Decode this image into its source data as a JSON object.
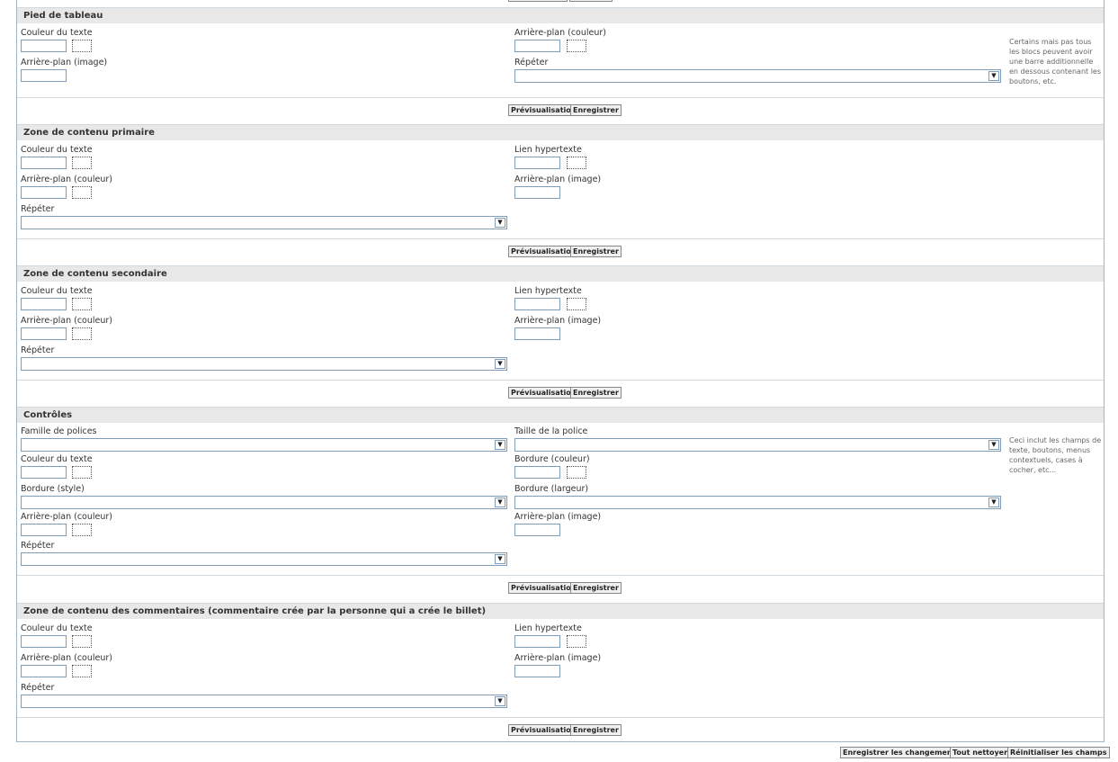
{
  "labels": {
    "text_color": "Couleur du texte",
    "bg_color": "Arrière-plan (couleur)",
    "bg_image": "Arrière-plan (image)",
    "repeat": "Répéter",
    "hyperlink": "Lien hypertexte",
    "font_family": "Famille de polices",
    "font_size": "Taille de la police",
    "border_color": "Bordure (couleur)",
    "border_style": "Bordure (style)",
    "border_width": "Bordure (largeur)"
  },
  "buttons": {
    "preview": "Prévisualisation",
    "save": "Enregistrer",
    "save_changes": "Enregistrer les changements",
    "clear_all": "Tout nettoyer",
    "reset_fields": "Réinitialiser les champs"
  },
  "sections": {
    "table_footer": {
      "title": "Pied de tableau",
      "note": "Certains mais pas tous les blocs peuvent avoir une barre additionnelle en dessous contenant les boutons, etc."
    },
    "primary_content": {
      "title": "Zone de contenu primaire"
    },
    "secondary_content": {
      "title": "Zone de contenu secondaire"
    },
    "controls": {
      "title": "Contrôles",
      "note": "Ceci inclut les champs de texte, boutons, menus contextuels, cases à cocher, etc..."
    },
    "comments_content": {
      "title": "Zone de contenu des commentaires (commentaire crée par la personne qui a crée le billet)"
    }
  },
  "icons": {
    "dropdown": "chevron-down-icon"
  }
}
